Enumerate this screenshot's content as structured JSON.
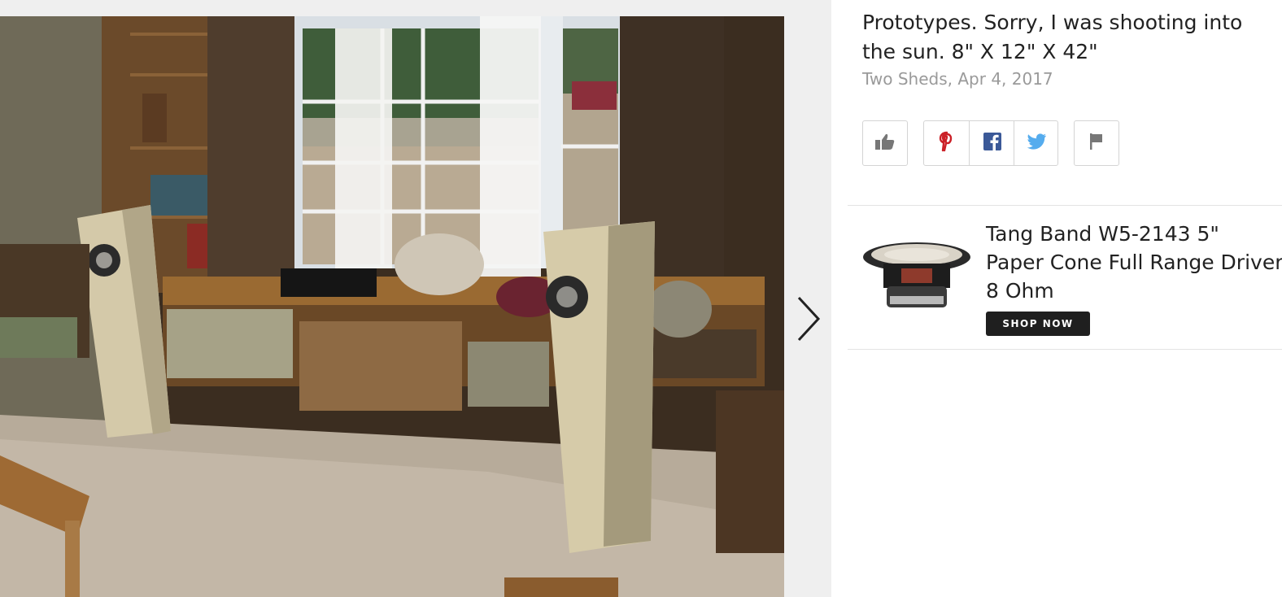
{
  "photo": {
    "alt_icon": "photo-of-speaker-prototypes"
  },
  "navigation": {
    "next_icon": "chevron-right-icon"
  },
  "caption": {
    "line1": "Prototypes. Sorry, I was shooting into",
    "line2": "the sun. 8\" X 12\" X 42\""
  },
  "meta": {
    "author_date": "Two Sheds, Apr 4, 2017"
  },
  "actions": {
    "like_icon": "thumbs-up-icon",
    "pinterest_icon": "pinterest-icon",
    "facebook_icon": "facebook-icon",
    "twitter_icon": "twitter-icon",
    "flag_icon": "flag-icon"
  },
  "product": {
    "title_line1": "Tang Band W5-2143 5\"",
    "title_line2": "Paper Cone Full Range Driver",
    "title_line3": "8 Ohm",
    "button_label": "SHOP NOW",
    "image_icon": "speaker-driver-image"
  },
  "colors": {
    "pinterest": "#cb2027",
    "facebook": "#3b5998",
    "twitter": "#55acee",
    "icon_gray": "#777777",
    "button_bg": "#1f1f1f"
  }
}
